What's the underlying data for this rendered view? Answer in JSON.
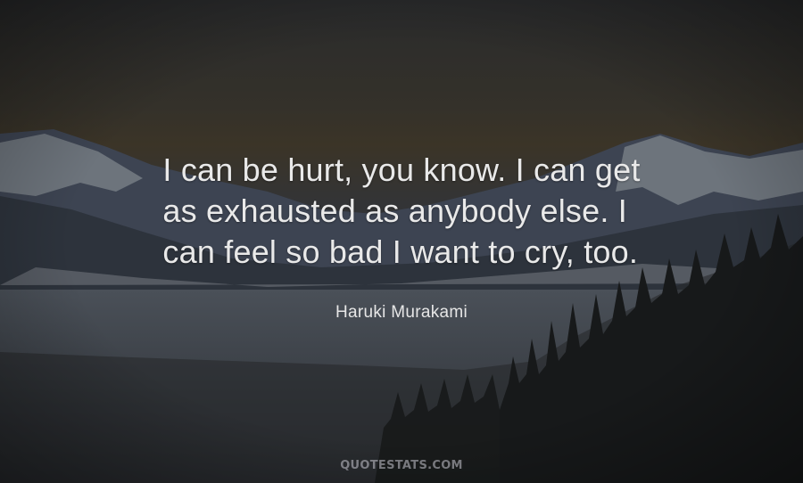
{
  "quote": {
    "lines": [
      "I can be hurt, you know. I can get",
      "as exhausted as anybody else. I",
      "can feel so bad I want to cry, too."
    ]
  },
  "author": "Haruki Murakami",
  "watermark": "QUOTESTATS.COM",
  "colors": {
    "sky_top": "#2b2a27",
    "sky_band": "#3a3427",
    "mountain": "#3b4350",
    "snow": "#8b9096",
    "valley_fog": "#3c4249",
    "forest": "#1b1c1c",
    "text": "#e9e9e9"
  }
}
